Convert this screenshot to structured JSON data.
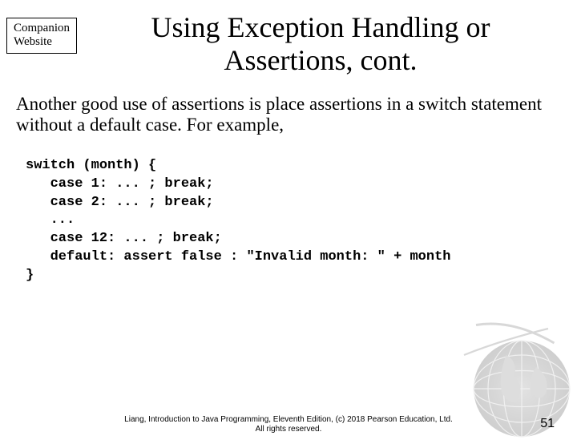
{
  "companion": {
    "line1": "Companion",
    "line2": "Website"
  },
  "title": "Using Exception Handling or Assertions, cont.",
  "body": "Another good use of assertions is place assertions in a switch statement without a default case. For example,",
  "code": "switch (month) {\n   case 1: ... ; break;\n   case 2: ... ; break;\n   ...\n   case 12: ... ; break;\n   default: assert false : \"Invalid month: \" + month\n}",
  "footer": {
    "line1": "Liang, Introduction to Java Programming, Eleventh Edition, (c) 2018 Pearson Education, Ltd.",
    "line2": "All rights reserved."
  },
  "page_number": "51"
}
